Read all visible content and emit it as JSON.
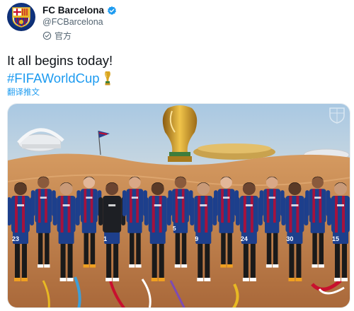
{
  "account": {
    "display_name": "FC Barcelona",
    "handle": "@FCBarcelona",
    "official_label": "官方"
  },
  "tweet": {
    "text": "It all begins today!",
    "hashtag": "#FIFAWorldCup",
    "translate_label": "翻译推文"
  },
  "media": {
    "players": [
      {
        "number": "23"
      },
      {
        "number": ""
      },
      {
        "number": ""
      },
      {
        "number": ""
      },
      {
        "number": "1"
      },
      {
        "number": ""
      },
      {
        "number": ""
      },
      {
        "number": "5"
      },
      {
        "number": "9"
      },
      {
        "number": ""
      },
      {
        "number": "24"
      },
      {
        "number": ""
      },
      {
        "number": "30"
      },
      {
        "number": ""
      },
      {
        "number": "15"
      }
    ],
    "colors": {
      "sky_top": "#b8d3e8",
      "sky_bottom": "#f0dcc4",
      "sand": "#c98a52",
      "kit_blue": "#1d3f8c",
      "kit_red": "#a5123d",
      "verified": "#1d9bf0"
    }
  }
}
